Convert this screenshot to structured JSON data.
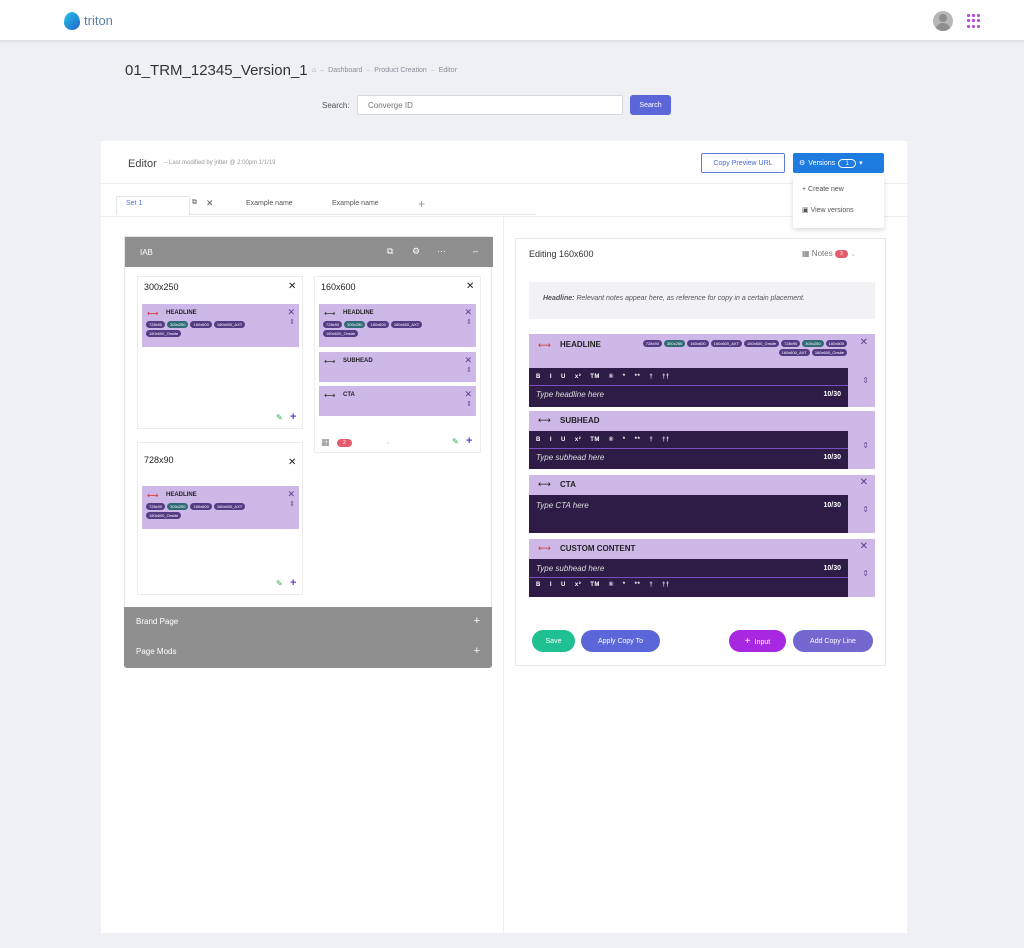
{
  "app": {
    "name": "triton"
  },
  "header": {
    "title": "01_TRM_12345_Version_1",
    "breadcrumb": [
      "Dashboard",
      "Product Creation",
      "Editor"
    ],
    "search_label": "Search:",
    "search_placeholder": "Converge ID",
    "search_button": "Search"
  },
  "editor": {
    "title": "Editor",
    "last_modified": "Last modified by jritter @ 2:00pm 1/1/19",
    "copy_preview": "Copy Preview URL",
    "versions_label": "Versions",
    "versions_count": "1",
    "menu": [
      "Create new",
      "View versions"
    ],
    "tabs": [
      "Set 1",
      "Example name",
      "Example name"
    ]
  },
  "iab": {
    "label": "IAB",
    "cards": {
      "c300": {
        "size": "300x250",
        "block": "HEADLINE"
      },
      "c160": {
        "size": "160x600",
        "blocks": [
          "HEADLINE",
          "SUBHEAD",
          "CTA"
        ],
        "badge": "2"
      },
      "c728": {
        "size": "728x90",
        "block": "HEADLINE"
      }
    },
    "chips": [
      "728x90",
      "300x250",
      "160x600",
      "160x600_AXT",
      "160x600_Onsite"
    ],
    "sections": [
      "Brand Page",
      "Page Mods"
    ]
  },
  "editing": {
    "title": "Editing 160x600",
    "notes_label": "Notes",
    "notes_count": "3",
    "note_label": "Headline:",
    "note_text": "Relevant notes appear here, as reference for copy in a certain placement.",
    "blocks": {
      "headline": {
        "label": "HEADLINE",
        "placeholder": "Type headline here",
        "counter": "10/30"
      },
      "subhead": {
        "label": "SUBHEAD",
        "placeholder": "Type subhead here",
        "counter": "10/30"
      },
      "cta": {
        "label": "CTA",
        "placeholder": "Type CTA here",
        "counter": "10/30"
      },
      "custom": {
        "label": "CUSTOM CONTENT",
        "placeholder": "Type subhead here",
        "counter": "10/30"
      }
    },
    "format": {
      "bold": "B",
      "italic": "I",
      "underline": "U",
      "superscript": "x²",
      "tm": "TM",
      "reg": "®",
      "star": "*",
      "dstar": "**",
      "dagger": "†",
      "ddagger": "††"
    },
    "buttons": {
      "save": "Save",
      "apply": "Apply Copy To",
      "input": "Input",
      "add": "Add Copy Line"
    }
  }
}
